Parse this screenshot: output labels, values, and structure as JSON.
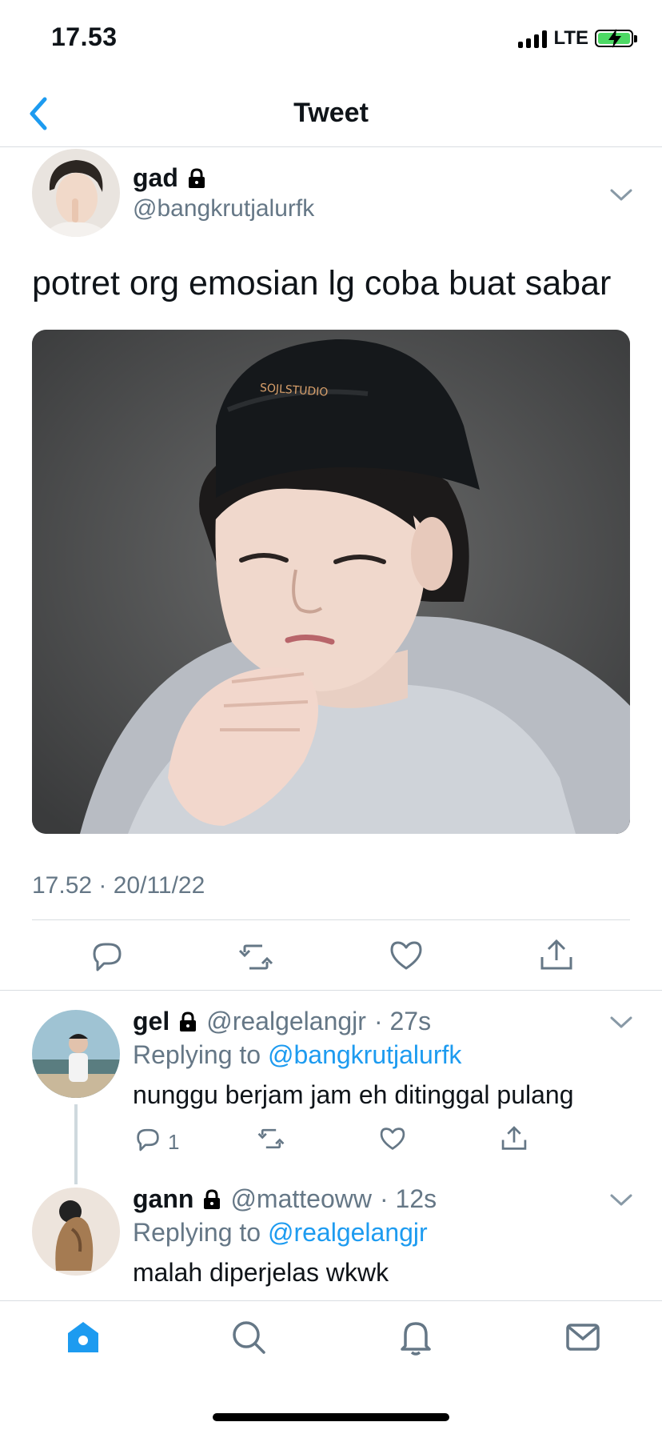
{
  "status_bar": {
    "time": "17.53",
    "network": "LTE",
    "battery_charging": true,
    "accent_green": "#4cd964"
  },
  "nav": {
    "title": "Tweet",
    "back_icon": "chevron-left-icon",
    "accent": "#1d9bf0"
  },
  "tweet": {
    "author_name": "gad",
    "author_handle": "@bangkrutjalurfk",
    "protected_icon": "lock-icon",
    "text": "potret org emosian lg coba buat sabar",
    "timestamp": "17.52 · 20/11/22",
    "actions": [
      "reply-icon",
      "retweet-icon",
      "like-icon",
      "share-icon"
    ]
  },
  "replies": [
    {
      "name": "gel",
      "handle": "@realgelangjr",
      "age": "· 27s",
      "replying_prefix": "Replying to",
      "replying_to": "@bangkrutjalurfk",
      "text": "nunggu berjam jam eh ditinggal pulang",
      "reply_count": "1"
    },
    {
      "name": "gann",
      "handle": "@matteoww",
      "age": "· 12s",
      "replying_prefix": "Replying to",
      "replying_to": "@realgelangjr",
      "text": "malah diperjelas wkwk"
    }
  ],
  "tab_bar": {
    "tabs": [
      "home-icon",
      "search-icon",
      "notifications-icon",
      "messages-icon"
    ],
    "active": "home-icon"
  },
  "colors": {
    "text_secondary": "#657786",
    "link": "#1d9bf0",
    "divider": "#d9dde1"
  }
}
